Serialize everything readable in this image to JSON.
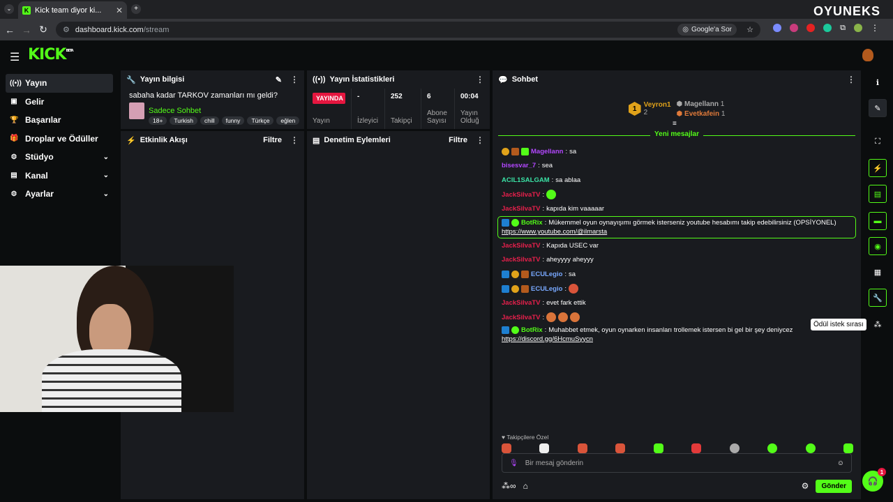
{
  "browser": {
    "tab_title": "Kick team diyor ki...",
    "url_host": "dashboard.kick.com",
    "url_path": "/stream",
    "google_ask": "Google'a Sor",
    "watermark": "OYUNEKS"
  },
  "header": {
    "logo": "KICK",
    "logo_badge": "BETA"
  },
  "sidebar": {
    "items": [
      {
        "label": "Yayın",
        "icon": "broadcast-icon",
        "expandable": false
      },
      {
        "label": "Gelir",
        "icon": "wallet-icon",
        "expandable": false
      },
      {
        "label": "Başarılar",
        "icon": "trophy-icon",
        "expandable": false
      },
      {
        "label": "Droplar ve Ödüller",
        "icon": "gift-icon",
        "expandable": false
      },
      {
        "label": "Stüdyo",
        "icon": "studio-icon",
        "expandable": true
      },
      {
        "label": "Kanal",
        "icon": "channel-icon",
        "expandable": true
      },
      {
        "label": "Ayarlar",
        "icon": "gear-icon",
        "expandable": true
      }
    ]
  },
  "stream_info": {
    "header": "Yayın bilgisi",
    "title": "sabaha kadar TARKOV zamanları mı geldi?",
    "category": "Sadece Sohbet",
    "tags": [
      "18+",
      "Turkish",
      "chill",
      "funny",
      "Türkçe",
      "eğlen"
    ]
  },
  "stats": {
    "header": "Yayın İstatistikleri",
    "live_badge": "YAYINDA",
    "live_label": "Yayın",
    "items": [
      {
        "value": "-",
        "label": "İzleyici"
      },
      {
        "value": "252",
        "label": "Takipçi"
      },
      {
        "value": "6",
        "label": "Abone Sayısı"
      },
      {
        "value": "00:04",
        "label": "Yayın Olduğ"
      }
    ]
  },
  "activity": {
    "header": "Etkinlik Akışı",
    "filter": "Filtre"
  },
  "moderation": {
    "header": "Denetim Eylemleri",
    "filter": "Filtre"
  },
  "chat": {
    "header": "Sohbet",
    "leaderboard": {
      "first": {
        "rank": "1",
        "name": "Veyron1",
        "count": "2"
      },
      "others": [
        {
          "name": "Magellann",
          "count": "1"
        },
        {
          "name": "Evetkafein",
          "count": "1"
        }
      ]
    },
    "new_messages": "Yeni mesajlar",
    "messages": [
      {
        "user": "Magellann",
        "color": "#b347ff",
        "text": "sa",
        "badges": [
          "sub-badge-1",
          "gift-badge",
          "green-badge"
        ]
      },
      {
        "user": "bisesvar_7",
        "color": "#b347ff",
        "text": "sea",
        "badges": []
      },
      {
        "user": "ACIL1SALGAM",
        "color": "#3ae2a5",
        "text": "sa ablaa",
        "badges": []
      },
      {
        "user": "JackSilvaTV",
        "color": "#e8204c",
        "text": "",
        "badges": [],
        "emote": "sunglasses-emote"
      },
      {
        "user": "JackSilvaTV",
        "color": "#e8204c",
        "text": "kapıda kim vaaaaar",
        "badges": []
      },
      {
        "user": "BotRix",
        "color": "#53fc18",
        "text": "Mükemmel oyun oynayışımı görmek isterseniz youtube hesabımı takip edebilirsiniz (OPSİYONEL)",
        "link": "https://www.youtube.com/@ilmarsta",
        "badges": [
          "mod-badge",
          "verified-badge"
        ],
        "bot": true
      },
      {
        "user": "JackSilvaTV",
        "color": "#e8204c",
        "text": "Kapıda USEC var",
        "badges": []
      },
      {
        "user": "JackSilvaTV",
        "color": "#e8204c",
        "text": "aheyyyy aheyyy",
        "badges": []
      },
      {
        "user": "ECULegio",
        "color": "#78a8ff",
        "text": "sa",
        "badges": [
          "mod-badge",
          "sub-badge-1",
          "gift-badge"
        ]
      },
      {
        "user": "ECULegio",
        "color": "#78a8ff",
        "text": "",
        "badges": [
          "mod-badge",
          "sub-badge-1",
          "gift-badge"
        ],
        "emote": "heart-emote"
      },
      {
        "user": "JackSilvaTV",
        "color": "#e8204c",
        "text": "evet fark ettik",
        "badges": []
      },
      {
        "user": "JackSilvaTV",
        "color": "#e8204c",
        "text": "",
        "badges": [],
        "emote": "thumbs-emotes"
      },
      {
        "user": "BotRix",
        "color": "#53fc18",
        "text": "Muhabbet etmek, oyun oynarken insanları trollemek istersen bi gel bir şey deniycez",
        "link": "https://discord.gg/6HcmuSyycn",
        "badges": [
          "mod-badge",
          "verified-badge"
        ],
        "bot": false
      }
    ],
    "followers_only": "Takipçilere Özel",
    "input_placeholder": "Bir mesaj gönderin",
    "send": "Gönder"
  },
  "rightbar": {
    "tooltip": "Ödül istek sırası",
    "help_count": "1"
  }
}
